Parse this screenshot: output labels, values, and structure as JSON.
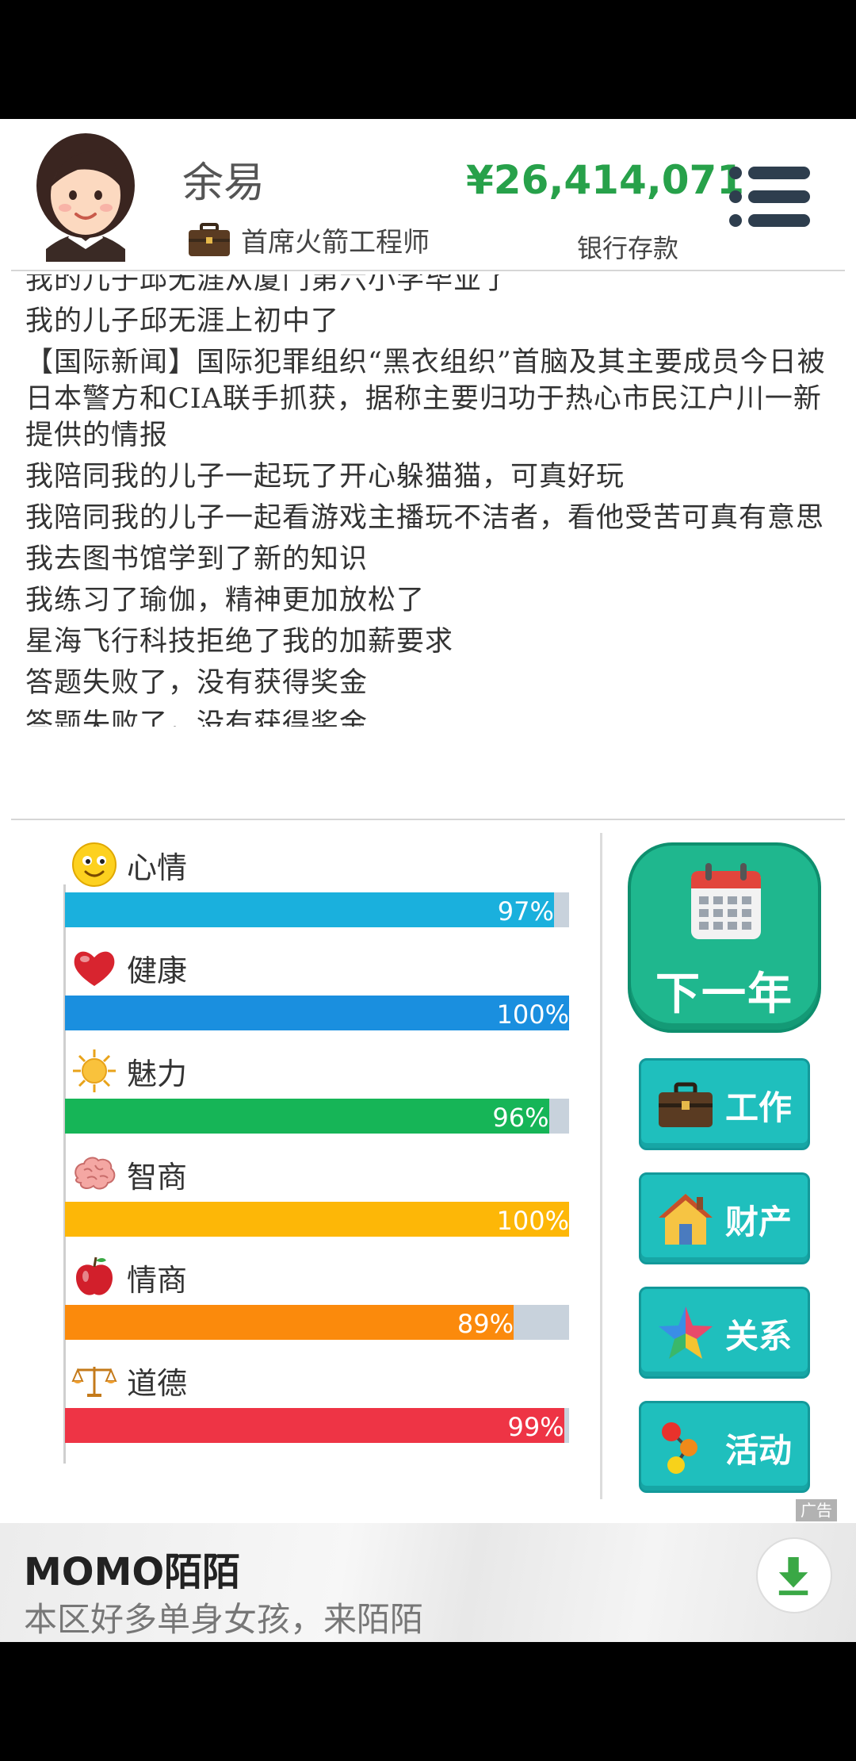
{
  "header": {
    "name": "余易",
    "job": "首席火箭工程师",
    "money": "¥26,414,071",
    "bank_label": "银行存款"
  },
  "log": [
    "我的儿子邱无涯从厦门第六小学毕业了",
    "我的儿子邱无涯上初中了",
    "【国际新闻】国际犯罪组织“黑衣组织”首脑及其主要成员今日被日本警方和CIA联手抓获，据称主要归功于热心市民江户川一新提供的情报",
    "我陪同我的儿子一起玩了开心躲猫猫，可真好玩",
    "我陪同我的儿子一起看游戏主播玩不洁者，看他受苦可真有意思",
    "我去图书馆学到了新的知识",
    "我练习了瑜伽，精神更加放松了",
    "星海飞行科技拒绝了我的加薪要求",
    "答题失败了，没有获得奖金",
    "答题失败了，没有获得奖金"
  ],
  "stats": [
    {
      "name": "心情",
      "value": 97,
      "label": "97%",
      "color": "#1ab0dd",
      "icon": "smiley-icon"
    },
    {
      "name": "健康",
      "value": 100,
      "label": "100%",
      "color": "#1a8fdf",
      "icon": "heart-icon"
    },
    {
      "name": "魅力",
      "value": 96,
      "label": "96%",
      "color": "#16b557",
      "icon": "sun-icon"
    },
    {
      "name": "智商",
      "value": 100,
      "label": "100%",
      "color": "#fdb707",
      "icon": "brain-icon"
    },
    {
      "name": "情商",
      "value": 89,
      "label": "89%",
      "color": "#fb8a0c",
      "icon": "apple-icon"
    },
    {
      "name": "道德",
      "value": 99,
      "label": "99%",
      "color": "#ee3445",
      "icon": "scales-icon"
    }
  ],
  "buttons": {
    "next_year": "下一年",
    "work": "工作",
    "property": "财产",
    "relations": "关系",
    "activity": "活动"
  },
  "ad": {
    "title": "MOMO陌陌",
    "subtitle": "本区好多单身女孩，来陌陌",
    "badge": "广告"
  }
}
